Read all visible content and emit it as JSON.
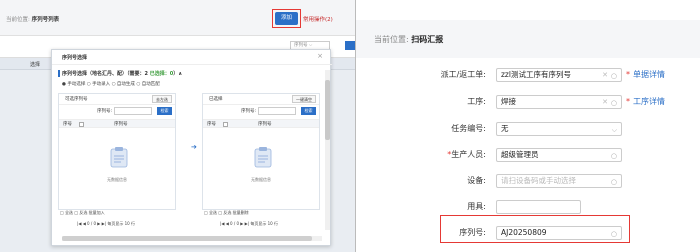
{
  "left": {
    "crumb_prefix": "当前位置:",
    "crumb_current": "序列号列表",
    "add_button": "添加",
    "common_actions": "常用操作(2)",
    "filter_placeholder": "序列号",
    "column_header": "选择",
    "modal": {
      "title": "序列号选择",
      "close": "×",
      "section_title": "序列号选择（地名汇丹、配）（需要：2",
      "section_selected": "已选择：0",
      "section_suffix": "）∧",
      "radio_options": "● 手动选择  ○ 手动录入  ○ 自动生成  ○ 自动匹配",
      "left_panel": {
        "title": "可选序列号",
        "button": "去左选",
        "search_label": "序列号:",
        "search_button": "检索",
        "col_index": "序号",
        "col_name": "序列号",
        "empty": "无数据信息",
        "footer1": "□ 全选  □ 反选  批量加入",
        "footer2": "|◀  ◀   0  / 0  ▶  ▶|  每页显示 10  行"
      },
      "right_panel": {
        "title": "已选择",
        "button": "一键清空",
        "search_label": "序列号:",
        "search_button": "检索",
        "col_index": "序号",
        "col_name": "序列号",
        "empty": "无数据信息",
        "footer1": "□ 全选  □ 反选  批量删除",
        "footer2": "|◀  ◀   0  / 0  ▶  ▶|  每页显示 10  行"
      },
      "arrow": "➔"
    }
  },
  "right": {
    "crumb_prefix": "当前位置:",
    "crumb_current": "扫码汇报",
    "fields": [
      {
        "label": "派工/返工单:",
        "value": "zzl测试工序有序列号",
        "required": false,
        "link": "单据详情"
      },
      {
        "label": "工序:",
        "value": "焊接",
        "required": false,
        "link": "工序详情"
      },
      {
        "label": "任务编号:",
        "value": "无",
        "required": false
      },
      {
        "label": "生产人员:",
        "value": "超级管理员",
        "required": true
      },
      {
        "label": "设备:",
        "value": "请扫设备码或手动选择",
        "required": false
      },
      {
        "label": "用具:",
        "value": "",
        "required": false
      },
      {
        "label": "序列号:",
        "value": "AJ20250809",
        "required": false
      }
    ],
    "required_mark": "*"
  },
  "colors": {
    "accent": "#2b6fc7",
    "highlight": "#e53935"
  }
}
